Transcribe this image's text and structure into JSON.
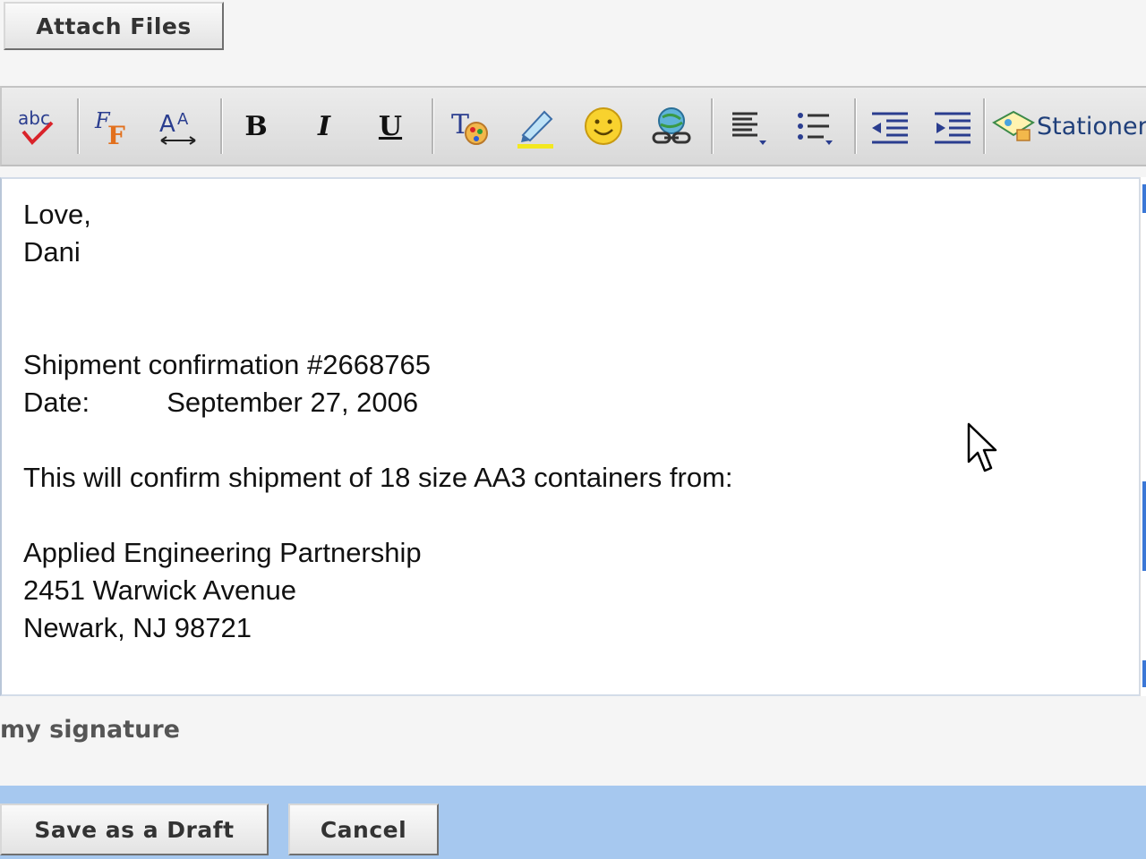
{
  "attach": {
    "label": "Attach Files"
  },
  "toolbar": {
    "stationery_label": "Stationer",
    "icons": [
      "spellcheck-icon",
      "font-face-icon",
      "font-size-icon",
      "bold-icon",
      "italic-icon",
      "underline-icon",
      "text-color-icon",
      "highlight-icon",
      "emoticon-icon",
      "insert-link-icon",
      "align-icon",
      "bullet-list-icon",
      "outdent-icon",
      "indent-icon",
      "stationery-icon"
    ],
    "bold_glyph": "B",
    "italic_glyph": "I",
    "underline_glyph": "U",
    "spell_glyph": "abc"
  },
  "editor": {
    "lines": [
      "Love,",
      "Dani",
      "Shipment confirmation #2668765",
      "Date:          September 27, 2006",
      "This will confirm shipment of 18 size AA3 containers from:",
      "Applied Engineering Partnership",
      "2451 Warwick Avenue",
      "Newark, NJ 98721"
    ]
  },
  "signature": {
    "label": "my signature"
  },
  "footer": {
    "save_draft_label": "Save as a Draft",
    "cancel_label": "Cancel"
  },
  "colors": {
    "footer_bar": "#a6c8ef",
    "toolbar_bg": "#e3e3e3",
    "link_blue": "#1f3f7a"
  }
}
